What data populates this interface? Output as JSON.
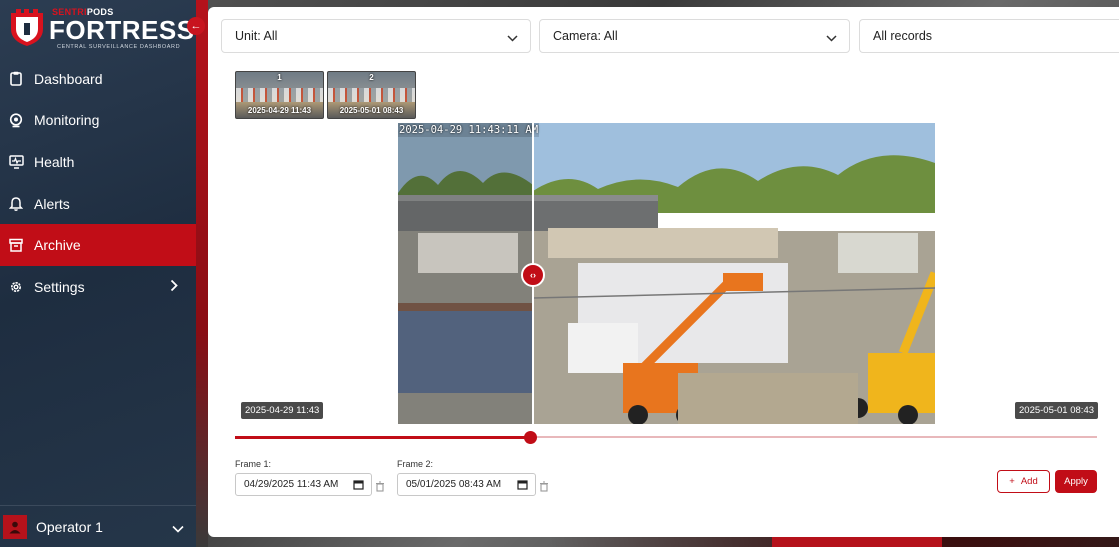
{
  "brand": {
    "prefix_red": "SENTRI",
    "prefix_white": "PODS",
    "name": "FORTRESS",
    "subtitle": "CENTRAL SURVEILLANCE DASHBOARD"
  },
  "sidebar": {
    "collapse_icon": "arrow-left-icon",
    "items": [
      {
        "label": "Dashboard",
        "icon": "clipboard-icon",
        "active": false
      },
      {
        "label": "Monitoring",
        "icon": "camera-lens-icon",
        "active": false
      },
      {
        "label": "Health",
        "icon": "monitor-pulse-icon",
        "active": false
      },
      {
        "label": "Alerts",
        "icon": "bell-icon",
        "active": false
      },
      {
        "label": "Archive",
        "icon": "archive-box-icon",
        "active": true
      },
      {
        "label": "Settings",
        "icon": "gear-icon",
        "active": false,
        "has_submenu": true
      }
    ],
    "user": {
      "name": "Operator 1",
      "icon": "user-icon"
    }
  },
  "filters": {
    "unit": "Unit: All",
    "camera": "Camera: All",
    "records": "All records"
  },
  "thumbnails": [
    {
      "number": "1",
      "date": "2025-04-29 11:43"
    },
    {
      "number": "2",
      "date": "2025-05-01 08:43"
    }
  ],
  "viewer": {
    "overlay_timestamp": "2025-04-29 11:43:11 AM",
    "left_label": "2025-04-29 11:43",
    "right_label": "2025-05-01 08:43",
    "slider_value": 0.343
  },
  "frames": {
    "frame1_label": "Frame 1:",
    "frame1_value": "04/29/2025 11:43 AM",
    "frame2_label": "Frame 2:",
    "frame2_value": "05/01/2025 08:43 AM"
  },
  "actions": {
    "add_label": "Add",
    "apply_label": "Apply"
  },
  "colors": {
    "accent": "#c10d17",
    "sidebar_bg": "#24344a"
  }
}
